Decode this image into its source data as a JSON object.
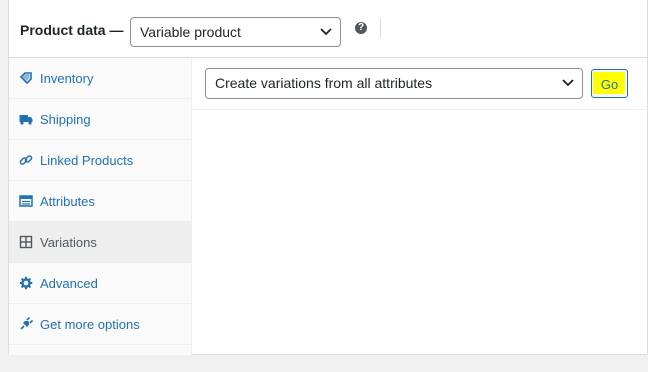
{
  "header": {
    "title": "Product data —",
    "product_type": "Variable product",
    "help_icon": "question-circle-icon"
  },
  "sidebar": {
    "items": [
      {
        "label": "Inventory",
        "icon": "inventory-tag-icon"
      },
      {
        "label": "Shipping",
        "icon": "truck-icon"
      },
      {
        "label": "Linked Products",
        "icon": "link-icon"
      },
      {
        "label": "Attributes",
        "icon": "attributes-list-icon"
      },
      {
        "label": "Variations",
        "icon": "grid-icon",
        "active": true
      },
      {
        "label": "Advanced",
        "icon": "gear-icon"
      },
      {
        "label": "Get more options",
        "icon": "plugin-plug-icon"
      }
    ]
  },
  "variations": {
    "bulk_action": "Create variations from all attributes",
    "go_label": "Go"
  },
  "colors": {
    "link": "#2271b1",
    "highlight": "#ffff00",
    "active_tab_bg": "#eeeeee"
  }
}
